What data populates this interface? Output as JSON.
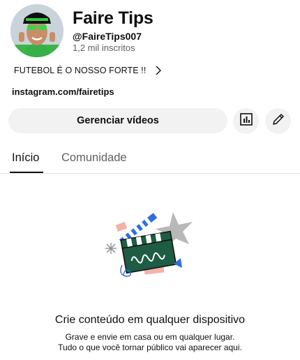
{
  "channel": {
    "name": "Faire Tips",
    "handle": "@FaireTips007",
    "subscribers": "1,2 mil inscritos",
    "description": "FUTEBOL É O NOSSO FORTE !!",
    "link": "instagram.com/fairetips"
  },
  "actions": {
    "manage_label": "Gerenciar vídeos",
    "analytics_icon": "analytics-icon",
    "edit_icon": "pencil-icon"
  },
  "tabs": [
    {
      "label": "Início",
      "active": true
    },
    {
      "label": "Comunidade",
      "active": false
    }
  ],
  "empty_state": {
    "title": "Crie conteúdo em qualquer dispositivo",
    "line1": "Grave e envie em casa ou em qualquer lugar.",
    "line2": "Tudo o que você tornar público vai aparecer aqui."
  },
  "colors": {
    "accent_green": "#1e5c44",
    "accent_blue": "#2c6fe0",
    "accent_pink": "#f1b3aa",
    "gray_star": "#b8b8b8"
  }
}
